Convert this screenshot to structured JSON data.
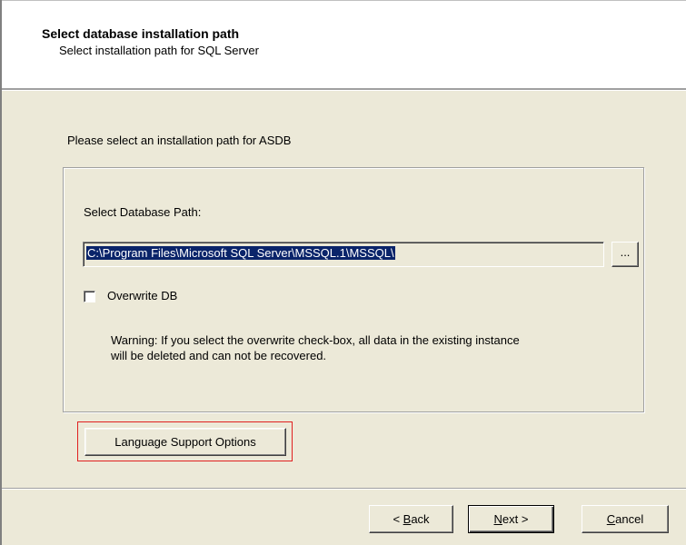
{
  "header": {
    "title": "Select database installation path",
    "subtitle": "Select installation path for SQL Server"
  },
  "main": {
    "prompt": "Please select an installation path for ASDB",
    "path_label": "Select Database Path:",
    "path_value": "C:\\Program Files\\Microsoft SQL Server\\MSSQL.1\\MSSQL\\",
    "browse_label": "...",
    "overwrite": {
      "label": "Overwrite DB",
      "checked": false
    },
    "warning_line1": "Warning: If you select the overwrite check-box, all data in the existing instance",
    "warning_line2": "will be deleted and can not be recovered.",
    "language_button": "Language Support Options"
  },
  "footer": {
    "back": {
      "mnemonic": "B",
      "rest": "ack",
      "prefix": "< "
    },
    "next": {
      "mnemonic": "N",
      "rest": "ext",
      "suffix": " >"
    },
    "cancel": {
      "mnemonic": "C",
      "rest": "ancel"
    }
  },
  "colors": {
    "dialog_face": "#ece9d8",
    "selection": "#0a246a",
    "highlight_box": "#e02020"
  }
}
